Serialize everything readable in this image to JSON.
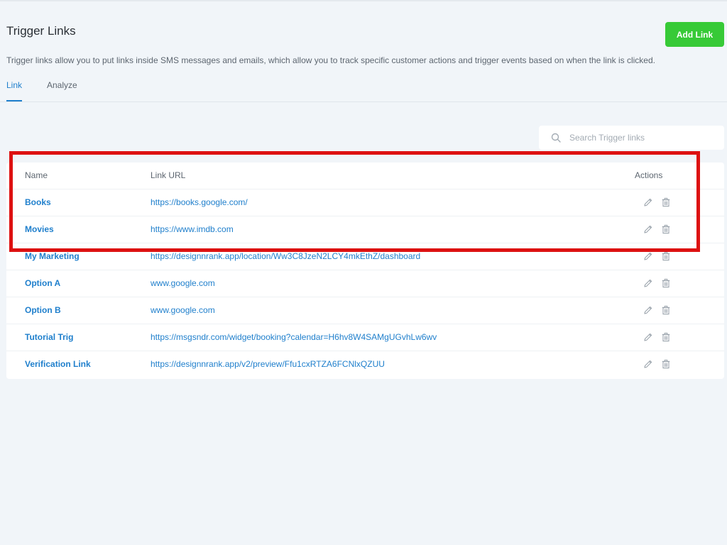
{
  "header": {
    "title": "Trigger Links",
    "add_button_label": "Add Link",
    "description": "Trigger links allow you to put links inside SMS messages and emails, which allow you to track specific customer actions and trigger events based on when the link is clicked."
  },
  "tabs": [
    {
      "label": "Link",
      "active": true
    },
    {
      "label": "Analyze",
      "active": false
    }
  ],
  "search": {
    "placeholder": "Search Trigger links",
    "value": "",
    "icon": "search-icon"
  },
  "table": {
    "columns": {
      "name": "Name",
      "url": "Link URL",
      "actions": "Actions"
    },
    "rows": [
      {
        "name": "Books",
        "url": "https://books.google.com/"
      },
      {
        "name": "Movies",
        "url": "https://www.imdb.com"
      },
      {
        "name": "My Marketing",
        "url": "https://designnrank.app/location/Ww3C8JzeN2LCY4mkEthZ/dashboard"
      },
      {
        "name": "Option A",
        "url": "www.google.com"
      },
      {
        "name": "Option B",
        "url": "www.google.com"
      },
      {
        "name": "Tutorial Trig",
        "url": "https://msgsndr.com/widget/booking?calendar=H6hv8W4SAMgUGvhLw6wv"
      },
      {
        "name": "Verification Link",
        "url": "https://designnrank.app/v2/preview/Ffu1cxRTZA6FCNlxQZUU"
      }
    ],
    "row_actions": [
      "pencil-icon",
      "trash-icon"
    ]
  },
  "colors": {
    "accent": "#1f7fcc",
    "add_button": "#37ca37",
    "highlight_border": "#dd1111",
    "background": "#f1f5f9"
  }
}
